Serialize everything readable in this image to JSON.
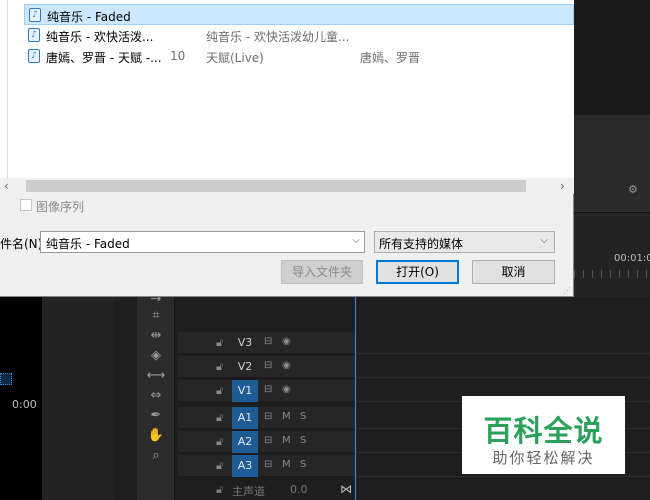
{
  "file_list": {
    "rows": [
      {
        "name": "纯音乐 - Faded",
        "num": "",
        "album": "",
        "artist": "",
        "selected": true
      },
      {
        "name": "纯音乐 - 欢快活泼...",
        "num": "",
        "album": "纯音乐 - 欢快活泼幼儿童...",
        "artist": ""
      },
      {
        "name": "唐嫣、罗晋 - 天赋 -...",
        "num": "10",
        "album": "天赋(Live)",
        "artist": "唐嫣、罗晋"
      }
    ]
  },
  "image_sequence_label": "图像序列",
  "filename_label": "件名(N):",
  "filename_value": "纯音乐 - Faded",
  "file_type_value": "所有支持的媒体",
  "buttons": {
    "import_folder": "导入文件夹",
    "open": "打开(O)",
    "cancel": "取消"
  },
  "premiere": {
    "timecode_left": "0:00",
    "timecode_right": "00:01:0",
    "tracks": [
      {
        "name": "V3",
        "active": false,
        "i1": "⊟",
        "i2": "◉",
        "i3": ""
      },
      {
        "name": "V2",
        "active": false,
        "i1": "⊟",
        "i2": "◉",
        "i3": ""
      },
      {
        "name": "V1",
        "active": true,
        "i1": "⊟",
        "i2": "◉",
        "i3": ""
      },
      {
        "name": "A1",
        "active": true,
        "i1": "⊟",
        "i2": "M",
        "i3": "S"
      },
      {
        "name": "A2",
        "active": true,
        "i1": "⊟",
        "i2": "M",
        "i3": "S"
      },
      {
        "name": "A3",
        "active": true,
        "i1": "⊟",
        "i2": "M",
        "i3": "S"
      }
    ],
    "master_label": "主声道",
    "master_value": "0.0"
  },
  "watermark": {
    "title": "百科全说",
    "subtitle": "助你轻松解决"
  },
  "colors": {
    "selection": "#cce8ff",
    "track_active": "#1d5c94",
    "playhead": "#3a8ee6",
    "watermark_green": "#2aa05a"
  }
}
